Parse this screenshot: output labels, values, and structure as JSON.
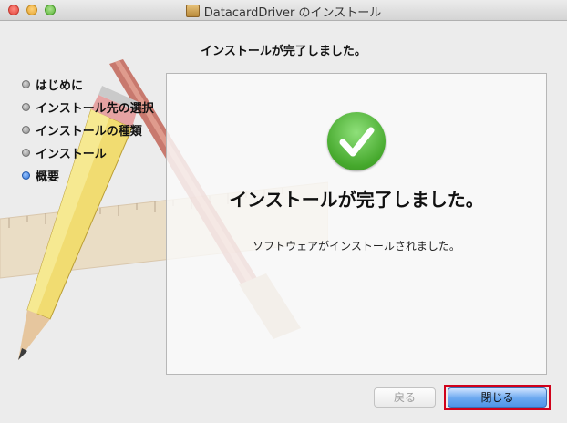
{
  "window": {
    "title": "DatacardDriver のインストール",
    "icon": "package-icon"
  },
  "heading": "インストールが完了しました。",
  "steps": [
    {
      "label": "はじめに",
      "active": false
    },
    {
      "label": "インストール先の選択",
      "active": false
    },
    {
      "label": "インストールの種類",
      "active": false
    },
    {
      "label": "インストール",
      "active": false
    },
    {
      "label": "概要",
      "active": true
    }
  ],
  "panel": {
    "icon": "checkmark-icon",
    "message": "インストールが完了しました。",
    "detail": "ソフトウェアがインストールされました。"
  },
  "buttons": {
    "back_label": "戻る",
    "close_label": "閉じる"
  },
  "colors": {
    "accent": "#4f94e6",
    "success": "#45a82c",
    "highlight": "#d0021b"
  }
}
